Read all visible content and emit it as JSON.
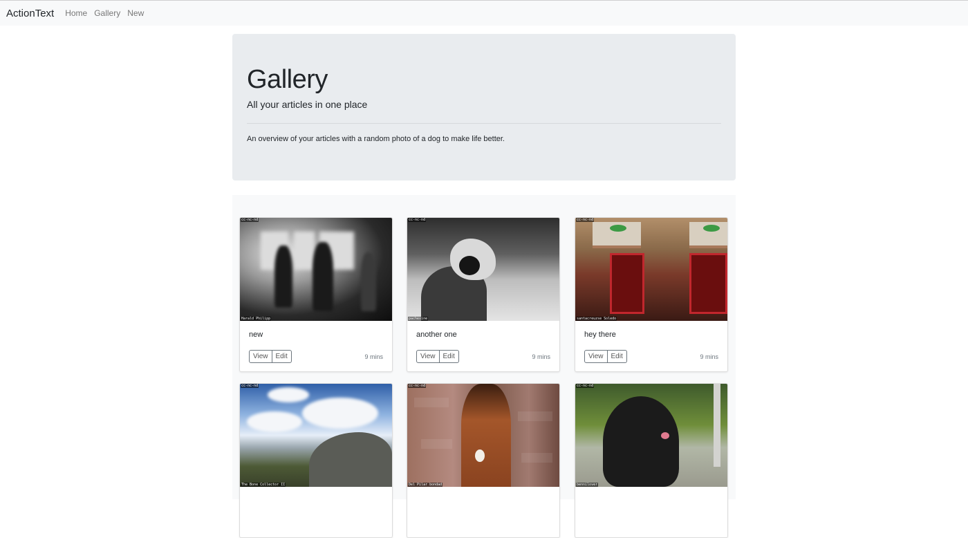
{
  "navbar": {
    "brand": "ActionText",
    "links": [
      "Home",
      "Gallery",
      "New"
    ]
  },
  "jumbotron": {
    "title": "Gallery",
    "lead": "All your articles in one place",
    "text": "An overview of your articles with a random photo of a dog to make life better."
  },
  "cards": [
    {
      "title": "new",
      "view_label": "View",
      "edit_label": "Edit",
      "time": "9 mins",
      "photo_credit": "Harald Philipp"
    },
    {
      "title": "another one",
      "view_label": "View",
      "edit_label": "Edit",
      "time": "9 mins",
      "photo_credit": "pachexine"
    },
    {
      "title": "hey there",
      "view_label": "View",
      "edit_label": "Edit",
      "time": "9 mins",
      "photo_credit": "santacreuzse Soledo"
    },
    {
      "photo_credit": "The Bone Collector II"
    },
    {
      "photo_credit": "Del Pilar bondad"
    },
    {
      "photo_credit": "bennilover"
    }
  ]
}
